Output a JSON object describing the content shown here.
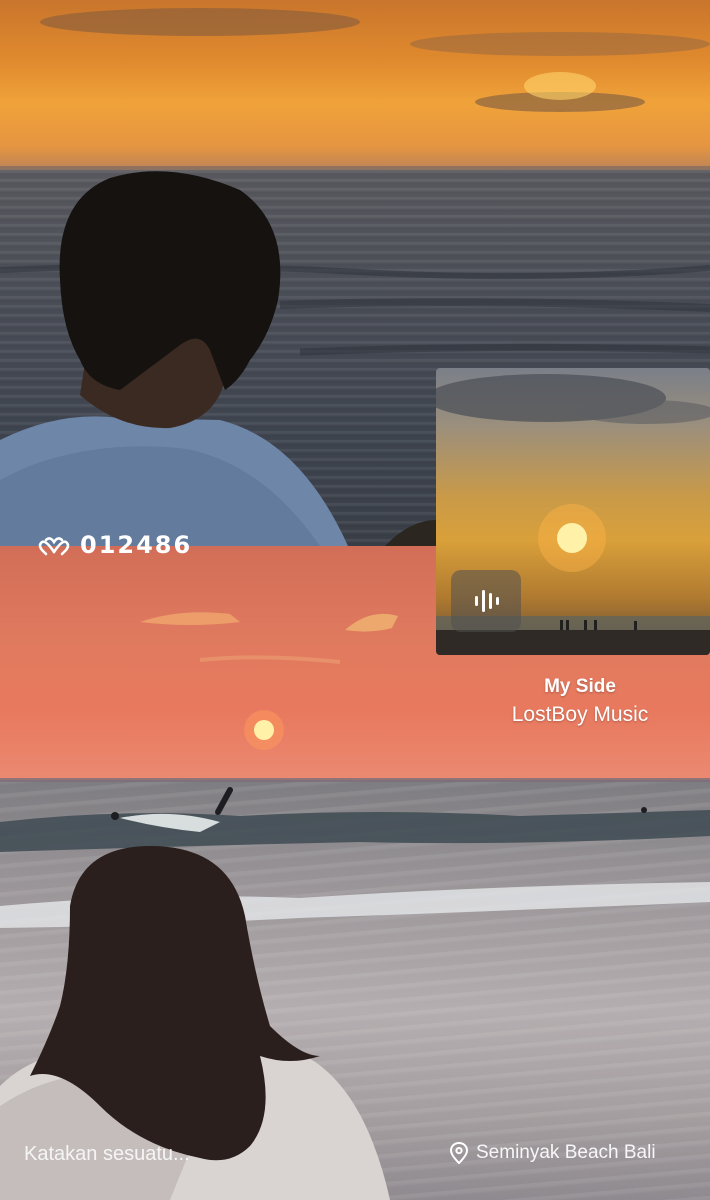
{
  "counter": {
    "value": "012486",
    "icon": "heart-hands-icon"
  },
  "music": {
    "title": "My Side",
    "artist": "LostBoy Music",
    "icon": "audio-wave-icon"
  },
  "comment": {
    "placeholder": "Katakan sesuatu..."
  },
  "location": {
    "icon": "location-pin-icon",
    "label": "Seminyak Beach Bali"
  },
  "colors": {
    "top_sky": "#e08a2e",
    "bottom_sky": "#e07a5f",
    "sun": "#fff1a8"
  }
}
